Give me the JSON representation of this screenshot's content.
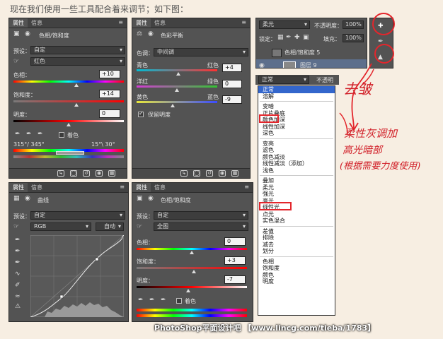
{
  "intro": "现在我们使用一些工具配合着来调节；如下图：",
  "tabs": {
    "properties": "属性",
    "info": "信息",
    "menu": "≡"
  },
  "panel_hs1": {
    "title": "色相/饱和度",
    "preset_label": "预设：",
    "preset_value": "自定",
    "channel_value": "红色",
    "hue_label": "色相：",
    "hue_value": "+10",
    "hue_pct": 0.57,
    "sat_label": "饱和度：",
    "sat_value": "+14",
    "sat_pct": 0.57,
    "light_label": "明度：",
    "light_value": "0",
    "light_pct": 0.5,
    "colorize_label": "着色",
    "range_left": "315°/ 345°",
    "range_right": "15°\\ 30°"
  },
  "panel_cb": {
    "title": "色彩平衡",
    "tone_label": "色调：",
    "tone_value": "中间调",
    "cyan": "青色",
    "red": "红色",
    "cr_value": "+4",
    "cr_pct": 0.52,
    "magenta": "洋红",
    "green": "绿色",
    "mg_value": "0",
    "mg_pct": 0.5,
    "yellow": "黄色",
    "blue": "蓝色",
    "yb_value": "-9",
    "yb_pct": 0.45,
    "preserve_label": "保留明度"
  },
  "layers": {
    "blend_value": "柔光",
    "opacity_label": "不透明度：",
    "opacity_value": "100%",
    "lock_label": "锁定：",
    "fill_label": "填充：",
    "fill_value": "100%",
    "layer1": "色相/饱和度 5",
    "layer2": "图层 9",
    "blend_value2": "正常",
    "opacity_label2": "不透明"
  },
  "blend_modes": {
    "group1": [
      "正常",
      "溶解"
    ],
    "group2": [
      "变暗",
      "正片叠底",
      "颜色加深",
      "线性加深",
      "深色"
    ],
    "group3": [
      "变亮",
      "滤色",
      "颜色减淡",
      "线性减淡（添加）",
      "浅色"
    ],
    "group4": [
      "叠加",
      "柔光",
      "强光",
      "亮光",
      "线性光",
      "点光",
      "实色混合"
    ],
    "group5": [
      "差值",
      "排除",
      "减去",
      "划分"
    ],
    "group6": [
      "色相",
      "饱和度",
      "颜色",
      "明度"
    ]
  },
  "panel_curves": {
    "title": "曲线",
    "preset_label": "预设：",
    "preset_value": "自定",
    "channel_value": "RGB",
    "auto_label": "自动"
  },
  "panel_hs2": {
    "title": "色相/饱和度",
    "preset_label": "预设：",
    "preset_value": "自定",
    "channel_value": "全图",
    "hue_label": "色相：",
    "hue_value": "0",
    "hue_pct": 0.5,
    "sat_label": "饱和度：",
    "sat_value": "+3",
    "sat_pct": 0.52,
    "light_label": "明度：",
    "light_value": "-7",
    "light_pct": 0.47,
    "colorize_label": "着色"
  },
  "notes": {
    "erase": "去皱",
    "line1": "柔性灰调加",
    "line2": "高光暗部",
    "line3": "(根据需要力度使用)"
  },
  "watermark": "PhotoShop平面设计吧 【www.lincg.com/tieba/1783】"
}
